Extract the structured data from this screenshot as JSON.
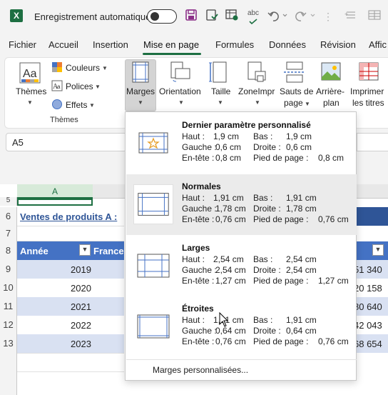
{
  "titlebar": {
    "app_icon": "excel-icon",
    "app_letter": "X",
    "autosave_label": "Enregistrement automatique",
    "toggle_state": "off",
    "qat": {
      "save_icon": "save-icon",
      "check_icon": "check-icon",
      "sheet_icon": "sheet-icon",
      "spell_text": "abc",
      "undo_icon": "undo-icon",
      "redo_icon": "redo-icon"
    }
  },
  "tabs": [
    "Fichier",
    "Accueil",
    "Insertion",
    "Mise en page",
    "Formules",
    "Données",
    "Révision",
    "Affic"
  ],
  "active_tab": "Mise en page",
  "ribbon": {
    "themes_label": "Thèmes",
    "couleurs": "Couleurs",
    "polices": "Polices",
    "effets": "Effets",
    "group_themes": "Thèmes",
    "marges": "Marges",
    "orientation": "Orientation",
    "taille": "Taille",
    "zone1": "ZoneImpr",
    "sauts1": "Sauts de",
    "sauts2": "page",
    "arriere1": "Arrière-",
    "arriere2": "plan",
    "imprimer1": "Imprimer",
    "imprimer2": "les titres"
  },
  "namebox": "A5",
  "sheet": {
    "col_a": "A",
    "row_numbers": [
      "5",
      "6",
      "7",
      "8",
      "9",
      "10",
      "11",
      "12",
      "13"
    ],
    "title": "Ventes de produits A :",
    "header_year": "Année",
    "header_france": "France",
    "years": [
      "2019",
      "2020",
      "2021",
      "2022",
      "2023"
    ],
    "right_values": [
      "51 340",
      "20 158",
      "80 640",
      "42 043",
      "68 654"
    ]
  },
  "menu": {
    "options": [
      {
        "title": "Dernier paramètre personnalisé",
        "haut": "1,9 cm",
        "bas": "1,9 cm",
        "gauche": "0,6 cm",
        "droite": "0,6 cm",
        "entete": "0,8 cm",
        "pied": "0,8 cm"
      },
      {
        "title": "Normales",
        "haut": "1,91 cm",
        "bas": "1,91 cm",
        "gauche": "1,78 cm",
        "droite": "1,78 cm",
        "entete": "0,76 cm",
        "pied": "0,76 cm"
      },
      {
        "title": "Larges",
        "haut": "2,54 cm",
        "bas": "2,54 cm",
        "gauche": "2,54 cm",
        "droite": "2,54 cm",
        "entete": "1,27 cm",
        "pied": "1,27 cm"
      },
      {
        "title": "Étroites",
        "haut": "1,91 cm",
        "bas": "1,91 cm",
        "gauche": "0,64 cm",
        "droite": "0,64 cm",
        "entete": "0,76 cm",
        "pied": "0,76 cm"
      }
    ],
    "labels": {
      "haut": "Haut :",
      "bas": "Bas :",
      "gauche": "Gauche :",
      "droite": "Droite :",
      "entete": "En-tête :",
      "pied": "Pied de page :"
    },
    "footer": "Marges personnalisées...",
    "hovered_option": "Normales"
  },
  "colors": {
    "excel_green": "#1d6f42",
    "table_header": "#4472c4",
    "table_band": "#d9e1f2",
    "title_bar_bg": "#2f5597"
  }
}
